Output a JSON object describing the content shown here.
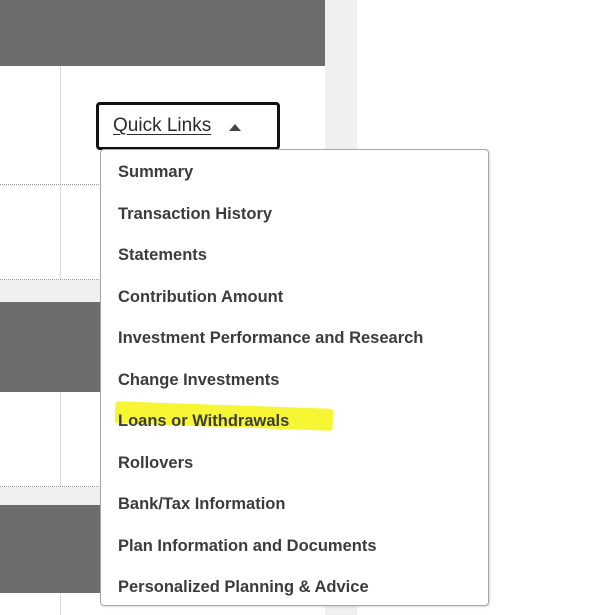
{
  "quick_links": {
    "button_label": "Quick Links",
    "caret_icon": "caret-up-icon",
    "items": [
      {
        "label": "Summary"
      },
      {
        "label": "Transaction History"
      },
      {
        "label": "Statements"
      },
      {
        "label": "Contribution Amount"
      },
      {
        "label": "Investment Performance and Research"
      },
      {
        "label": "Change Investments"
      },
      {
        "label": "Loans or Withdrawals",
        "highlighted": true
      },
      {
        "label": "Rollovers"
      },
      {
        "label": "Bank/Tax Information"
      },
      {
        "label": "Plan Information and Documents"
      },
      {
        "label": "Personalized Planning & Advice"
      }
    ]
  },
  "colors": {
    "header_bar": "#6d6d6d",
    "highlight": "#f5f52a",
    "button_border": "#111111"
  }
}
